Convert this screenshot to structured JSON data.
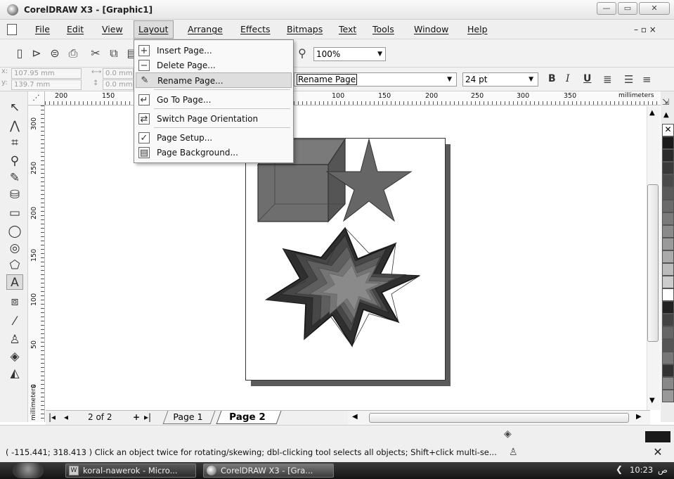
{
  "window": {
    "title": "CorelDRAW X3 - [Graphic1]",
    "min_label": "—",
    "max_label": "▭",
    "close_label": "✕"
  },
  "menubar": {
    "items": [
      "File",
      "Edit",
      "View",
      "Layout",
      "Arrange",
      "Effects",
      "Bitmaps",
      "Text",
      "Tools",
      "Window",
      "Help"
    ],
    "doc_controls": "–  ▫  ×"
  },
  "toolbar": {
    "zoom_value": "100%"
  },
  "propbar": {
    "x_label": "x:",
    "x_value": "107.95 mm",
    "y_label": "y:",
    "y_value": "139.7 mm",
    "w_value": "0.0 mm",
    "h_value": "0.0 mm",
    "font_name": "Rename Page",
    "font_size": "24 pt",
    "bold": "B",
    "italic": "I",
    "underline": "U"
  },
  "layout_menu": {
    "items": [
      {
        "label": "Insert Page...",
        "icon": "insert-page-icon"
      },
      {
        "label": "Delete Page...",
        "icon": "delete-page-icon"
      },
      {
        "label": "Rename Page...",
        "icon": "rename-page-icon"
      },
      {
        "label": "Go To Page...",
        "icon": "goto-page-icon"
      },
      {
        "label": "Switch Page Orientation",
        "icon": "orientation-icon"
      },
      {
        "label": "Page Setup...",
        "icon": "page-setup-icon"
      },
      {
        "label": "Page Background...",
        "icon": "page-background-icon"
      }
    ],
    "highlighted": "Rename Page..."
  },
  "ruler": {
    "top_ticks": [
      "200",
      "150",
      "100",
      "150",
      "200",
      "250",
      "300",
      "350"
    ],
    "unit": "millimeters",
    "left_ticks": [
      "300",
      "250",
      "200",
      "150",
      "100",
      "50",
      "0"
    ],
    "left_unit": "millimeters"
  },
  "page_nav": {
    "count": "2 of 2",
    "tabs": [
      "Page 1",
      "Page 2"
    ],
    "active_tab": "Page 2"
  },
  "status": {
    "text": "( -115.441; 318.413 )  Click an object twice for rotating/skewing; dbl-clicking tool selects all objects; Shift+click multi-se..."
  },
  "taskbar": {
    "items": [
      "koral-nawerok - Micro...",
      "CorelDRAW X3 - [Gra..."
    ],
    "clock": "10:23",
    "clock_suffix": "ص"
  },
  "palette_colors": [
    "#ffffff",
    "#1a1a1a",
    "#2a2a2a",
    "#3a3a3a",
    "#4a4a4a",
    "#5a5a5a",
    "#6a6a6a",
    "#7a7a7a",
    "#8a8a8a",
    "#9a9a9a",
    "#aaaaaa",
    "#bbbbbb",
    "#cccccc",
    "#ffffff",
    "#222222",
    "#444444",
    "#666666",
    "#555555",
    "#777777",
    "#333333",
    "#888888",
    "#999999"
  ]
}
